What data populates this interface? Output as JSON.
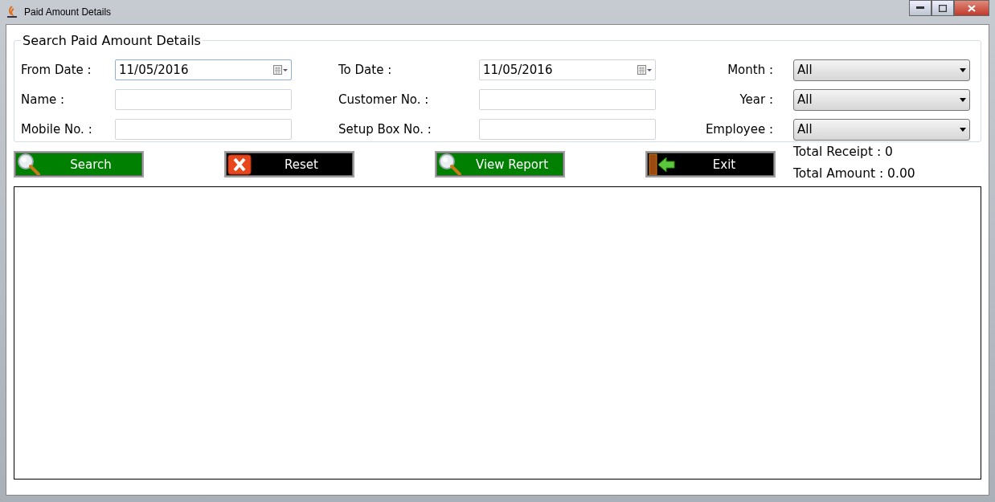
{
  "window": {
    "title": "Paid Amount Details"
  },
  "search_group": {
    "title": "Search Paid Amount Details",
    "fields": [
      {
        "label": "From Date :",
        "kind": "date",
        "value": "11/05/2016",
        "focused": true
      },
      {
        "label": "To Date :",
        "kind": "date",
        "value": "11/05/2016",
        "focused": false
      },
      {
        "label": "Month :",
        "kind": "combo",
        "value": "All"
      },
      {
        "label": "Name :",
        "kind": "text"
      },
      {
        "label": "Customer No. :",
        "kind": "text"
      },
      {
        "label": "Year :",
        "kind": "combo",
        "value": "All"
      },
      {
        "label": "Mobile No. :",
        "kind": "text"
      },
      {
        "label": "Setup Box No. :",
        "kind": "text"
      },
      {
        "label": "Employee :",
        "kind": "combo",
        "value": "All"
      }
    ]
  },
  "buttons": [
    {
      "label": "Search",
      "kind": "search",
      "color": "#008000"
    },
    {
      "label": "Reset",
      "kind": "reset",
      "color": "#000000"
    },
    {
      "label": "View Report",
      "kind": "search",
      "color": "#008000"
    },
    {
      "label": "Exit",
      "kind": "exit",
      "color": "#000000"
    }
  ],
  "totals": [
    "Total Receipt : 0",
    "Total Amount : 0.00"
  ]
}
